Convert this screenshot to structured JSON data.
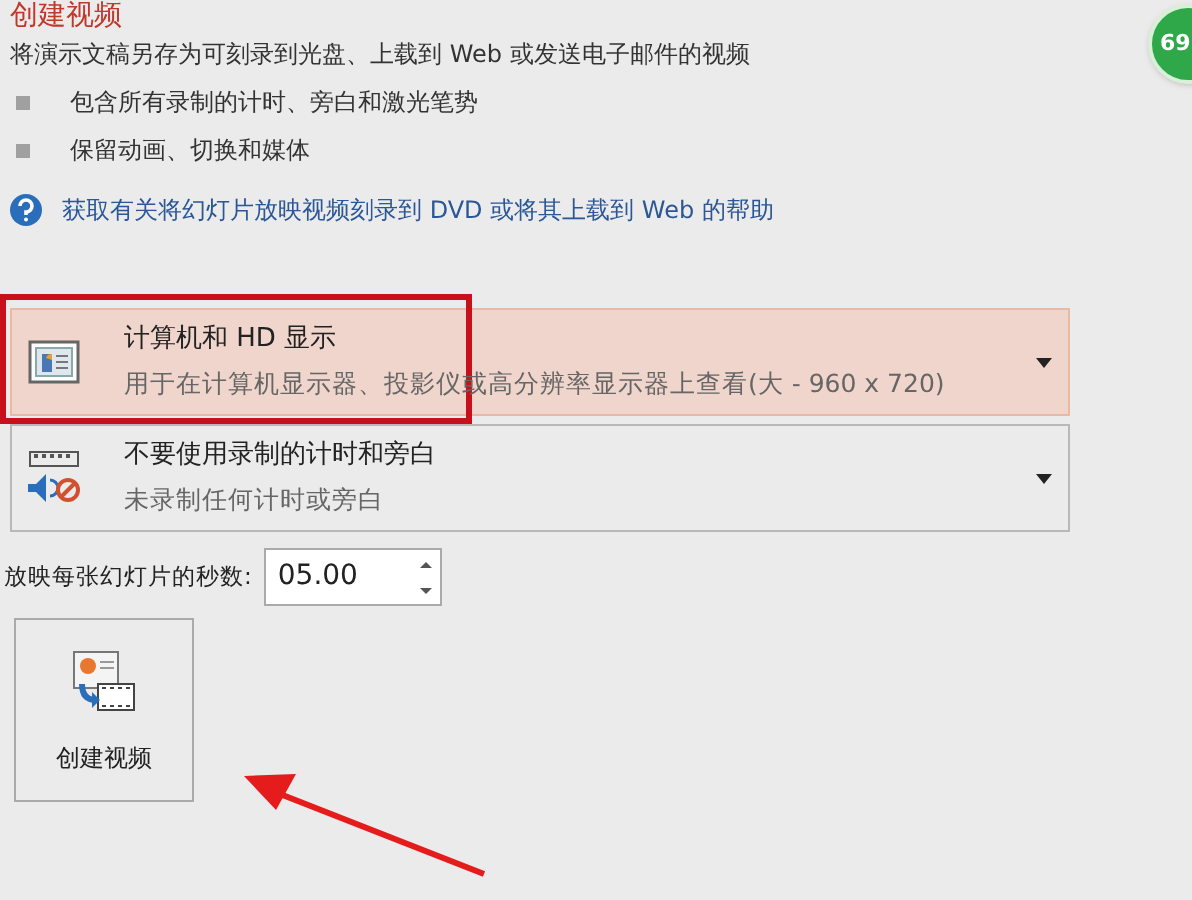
{
  "title": "创建视频",
  "description": "将演示文稿另存为可刻录到光盘、上载到 Web 或发送电子邮件的视频",
  "bullets": [
    "包含所有录制的计时、旁白和激光笔势",
    "保留动画、切换和媒体"
  ],
  "help_link": "获取有关将幻灯片放映视频刻录到 DVD 或将其上载到 Web 的帮助",
  "dropdowns": [
    {
      "title": "计算机和 HD 显示",
      "subtitle": "用于在计算机显示器、投影仪或高分辨率显示器上查看(大 - 960 x 720)",
      "highlighted": true
    },
    {
      "title": "不要使用录制的计时和旁白",
      "subtitle": "未录制任何计时或旁白",
      "highlighted": false
    }
  ],
  "seconds": {
    "label": "放映每张幻灯片的秒数:",
    "value": "05.00"
  },
  "create_button": "创建视频",
  "badge": "69"
}
